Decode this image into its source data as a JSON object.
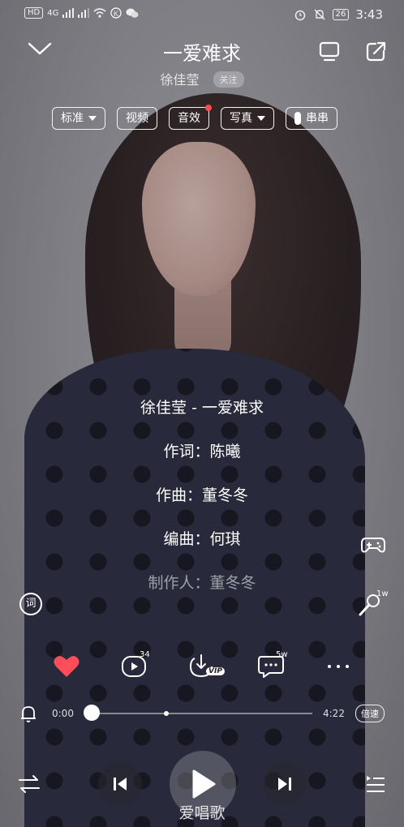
{
  "status_bar": {
    "left_labels": [
      "HD",
      "4G"
    ],
    "battery": "26",
    "time": "3:43"
  },
  "song": {
    "title": "一爱难求",
    "artist": "徐佳莹",
    "follow_label": "关注"
  },
  "chips": [
    {
      "label": "标准",
      "dropdown": true
    },
    {
      "label": "视频"
    },
    {
      "label": "音效",
      "dot": true
    },
    {
      "label": "写真",
      "dropdown": true
    },
    {
      "label": "串串",
      "toggle": true
    }
  ],
  "lyrics": [
    {
      "text": "徐佳莹 - 一爱难求"
    },
    {
      "text": "作词：陈曦"
    },
    {
      "text": "作曲：董冬冬"
    },
    {
      "text": "编曲：何琪"
    },
    {
      "text": "制作人：董冬冬"
    }
  ],
  "side": {
    "lyrics_btn": "词",
    "mic_count": "1w"
  },
  "actions": {
    "video_count": "34",
    "download_badge": "VIP",
    "comment_count": "5w"
  },
  "progress": {
    "current": "0:00",
    "total": "4:22",
    "fraction": 0.0,
    "speed_label": "倍速"
  },
  "watermark": "爱唱歌",
  "colors": {
    "heart": "#ff4d5a",
    "dot": "#ff4d4d"
  }
}
